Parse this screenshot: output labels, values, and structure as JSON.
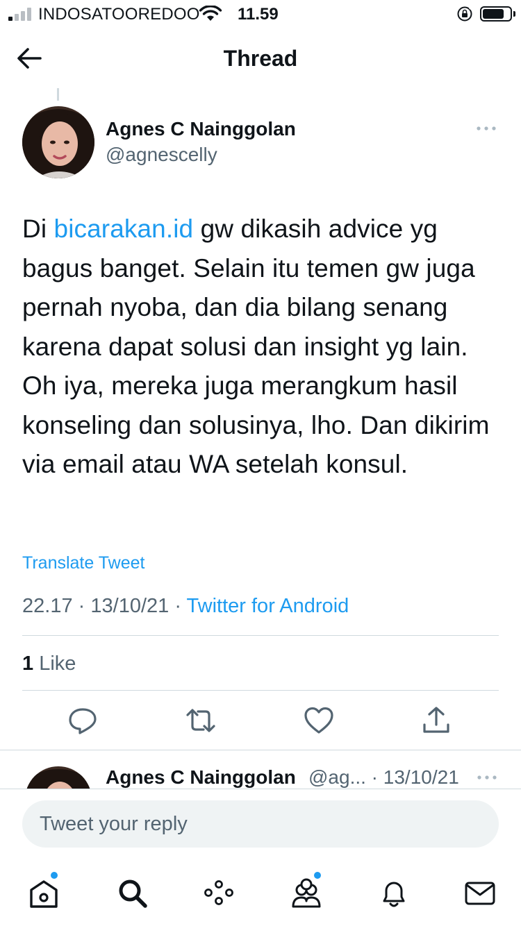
{
  "status_bar": {
    "carrier": "INDOSATOOREDOO",
    "time": "11.59",
    "signal_bars_filled": 1,
    "battery_level": 0.7
  },
  "header": {
    "title": "Thread",
    "back_icon": "arrow-left-icon"
  },
  "tweet": {
    "author_name": "Agnes C Nainggolan",
    "author_handle": "@agnescelly",
    "text_prefix": "Di ",
    "text_link": "bicarakan.id",
    "text_suffix": " gw dikasih advice yg bagus banget. Selain itu temen gw juga pernah nyoba, dan dia bilang senang karena dapat solusi dan insight yg lain. Oh iya, mereka juga merangkum hasil konseling dan solusinya, lho. Dan dikirim via email atau WA setelah konsul.",
    "translate_label": "Translate Tweet",
    "time": "22.17",
    "separator": "·",
    "date": "13/10/21",
    "source": "Twitter for Android",
    "like_count": "1",
    "like_label": "Like",
    "actions": [
      "reply-icon",
      "retweet-icon",
      "like-icon",
      "share-icon"
    ]
  },
  "next_tweet": {
    "author_name": "Agnes C Nainggolan",
    "handle_date": "@ag... · 13/10/21"
  },
  "reply": {
    "placeholder": "Tweet your reply"
  },
  "bottom_nav": {
    "items": [
      "home-icon",
      "search-icon",
      "spaces-icon",
      "communities-icon",
      "notifications-icon",
      "messages-icon"
    ]
  },
  "colors": {
    "accent": "#1d9bf0",
    "text": "#0f1419",
    "secondary": "#536471",
    "divider": "#cfd9de"
  }
}
